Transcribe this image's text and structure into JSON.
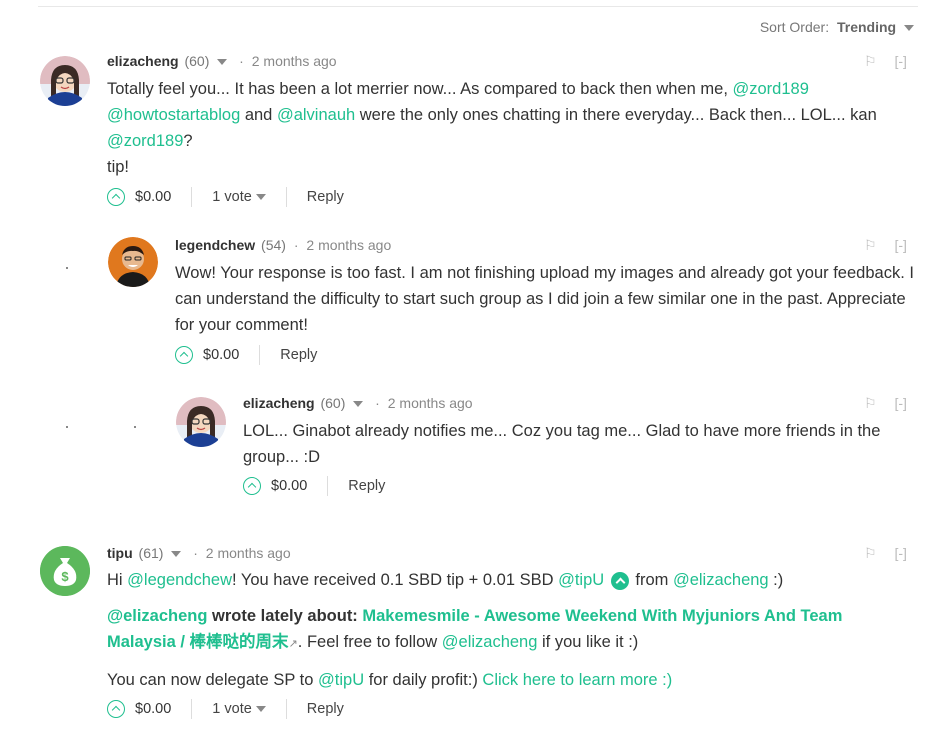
{
  "sort": {
    "label": "Sort Order:",
    "value": "Trending"
  },
  "comments": [
    {
      "author": "elizacheng",
      "rep": "(60)",
      "time": "2 months ago",
      "flag": "⚐",
      "collapse": "[-]",
      "body": {
        "t1": "Totally feel you... It has been a lot merrier now... As compared to back then when me, ",
        "m1": "@zord189",
        "m2": "@howtostartablog",
        "t2": " and ",
        "m3": "@alvinauh",
        "t3": " were the only ones chatting in there everyday... Back then... LOL... kan",
        "m4": "@zord189",
        "t4": "?",
        "t5": "tip!"
      },
      "payout": "$0.00",
      "votes": "1 vote",
      "reply": "Reply"
    },
    {
      "author": "legendchew",
      "rep": "(54)",
      "time": "2 months ago",
      "flag": "⚐",
      "collapse": "[-]",
      "body": {
        "t1": "Wow! Your response is too fast. I am not finishing upload my images and already got your feedback. I can understand the difficulty to start such group as I did join a few similar one in the past. Appreciate for your comment!"
      },
      "payout": "$0.00",
      "reply": "Reply"
    },
    {
      "author": "elizacheng",
      "rep": "(60)",
      "time": "2 months ago",
      "flag": "⚐",
      "collapse": "[-]",
      "body": {
        "t1": "LOL... Ginabot already notifies me... Coz you tag me... Glad to have more friends in the group... :D"
      },
      "payout": "$0.00",
      "reply": "Reply"
    },
    {
      "author": "tipu",
      "rep": "(61)",
      "time": "2 months ago",
      "flag": "⚐",
      "collapse": "[-]",
      "body": {
        "p1a": "Hi ",
        "p1m1": "@legendchew",
        "p1b": "! You have received 0.1 SBD tip + 0.01 SBD ",
        "p1m2": "@tipU",
        "p1c": " from ",
        "p1m3": "@elizacheng",
        "p1d": " :)",
        "p2m": "@elizacheng",
        "p2b": " wrote lately about: ",
        "p2link": "Makemesmile - Awesome Weekend With Myjuniors And Team Malaysia / 棒棒哒的周末",
        "p2c": ". Feel free to follow ",
        "p2m2": "@elizacheng",
        "p2d": " if you like it :)",
        "p3a": "You can now delegate SP to ",
        "p3m": "@tipU",
        "p3b": " for daily profit:) ",
        "p3link": "Click here to learn more :)"
      },
      "payout": "$0.00",
      "votes": "1 vote",
      "reply": "Reply"
    }
  ],
  "colors": {
    "accent": "#1fbf8f",
    "text": "#333333",
    "muted": "#888888"
  }
}
